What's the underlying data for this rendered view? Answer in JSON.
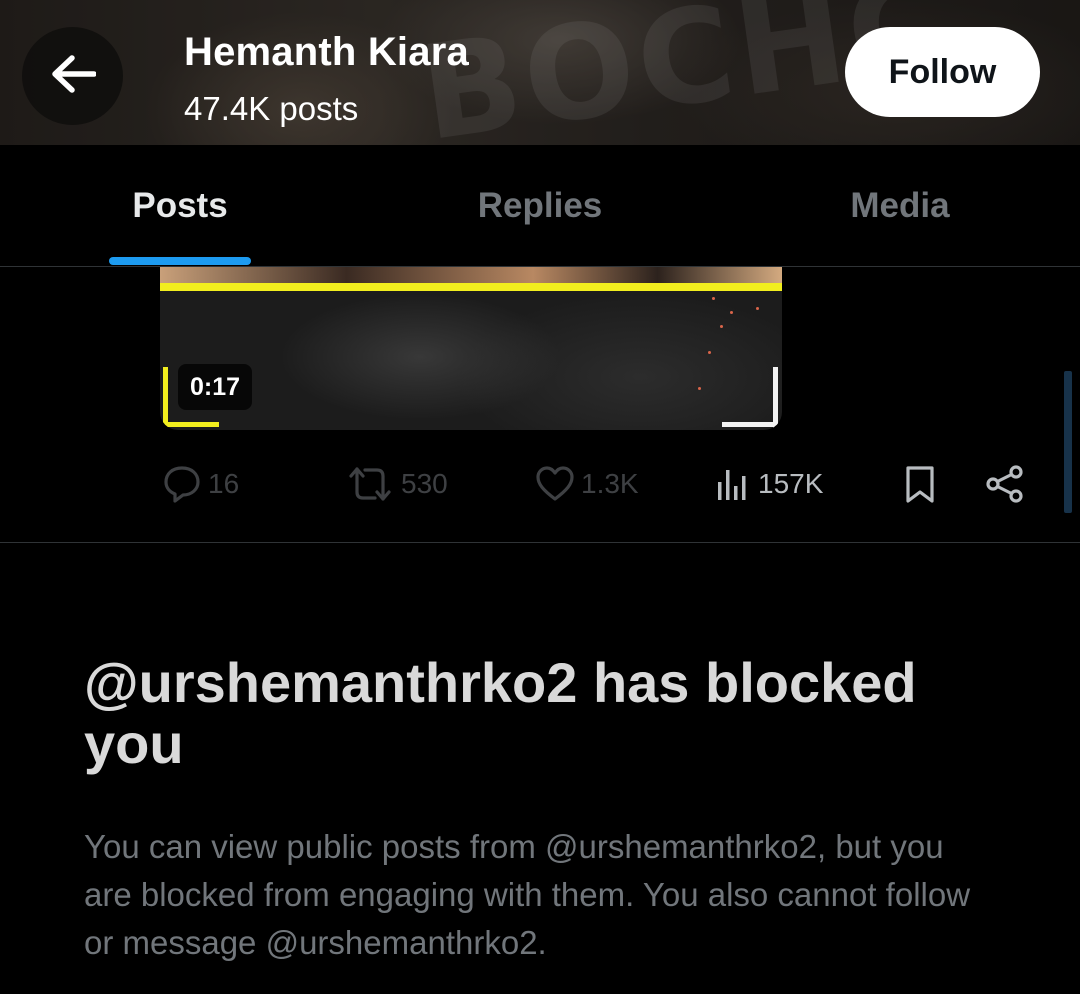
{
  "header": {
    "name": "Hemanth Kiara",
    "posts_count": "47.4K posts",
    "follow_label": "Follow",
    "back_icon": "arrow-left-icon"
  },
  "tabs": [
    {
      "label": "Posts",
      "active": true
    },
    {
      "label": "Replies",
      "active": false
    },
    {
      "label": "Media",
      "active": false
    }
  ],
  "post": {
    "video_duration": "0:17",
    "actions": {
      "replies": {
        "icon": "reply-icon",
        "count": "16"
      },
      "reposts": {
        "icon": "repost-icon",
        "count": "530"
      },
      "likes": {
        "icon": "heart-icon",
        "count": "1.3K"
      },
      "views": {
        "icon": "views-chart-icon",
        "count": "157K"
      },
      "bookmark": {
        "icon": "bookmark-icon"
      },
      "share": {
        "icon": "share-icon"
      }
    }
  },
  "blocked_notice": {
    "title": "@urshemanthrko2 has blocked you",
    "description": "You can view public posts from @urshemanthrko2, but you are blocked from engaging with them. You also cannot follow or message @urshemanthrko2."
  },
  "colors": {
    "accent": "#1d9bf0",
    "muted_text": "#71767b",
    "background": "#000000",
    "video_frame_yellow": "#f2ee1e"
  }
}
